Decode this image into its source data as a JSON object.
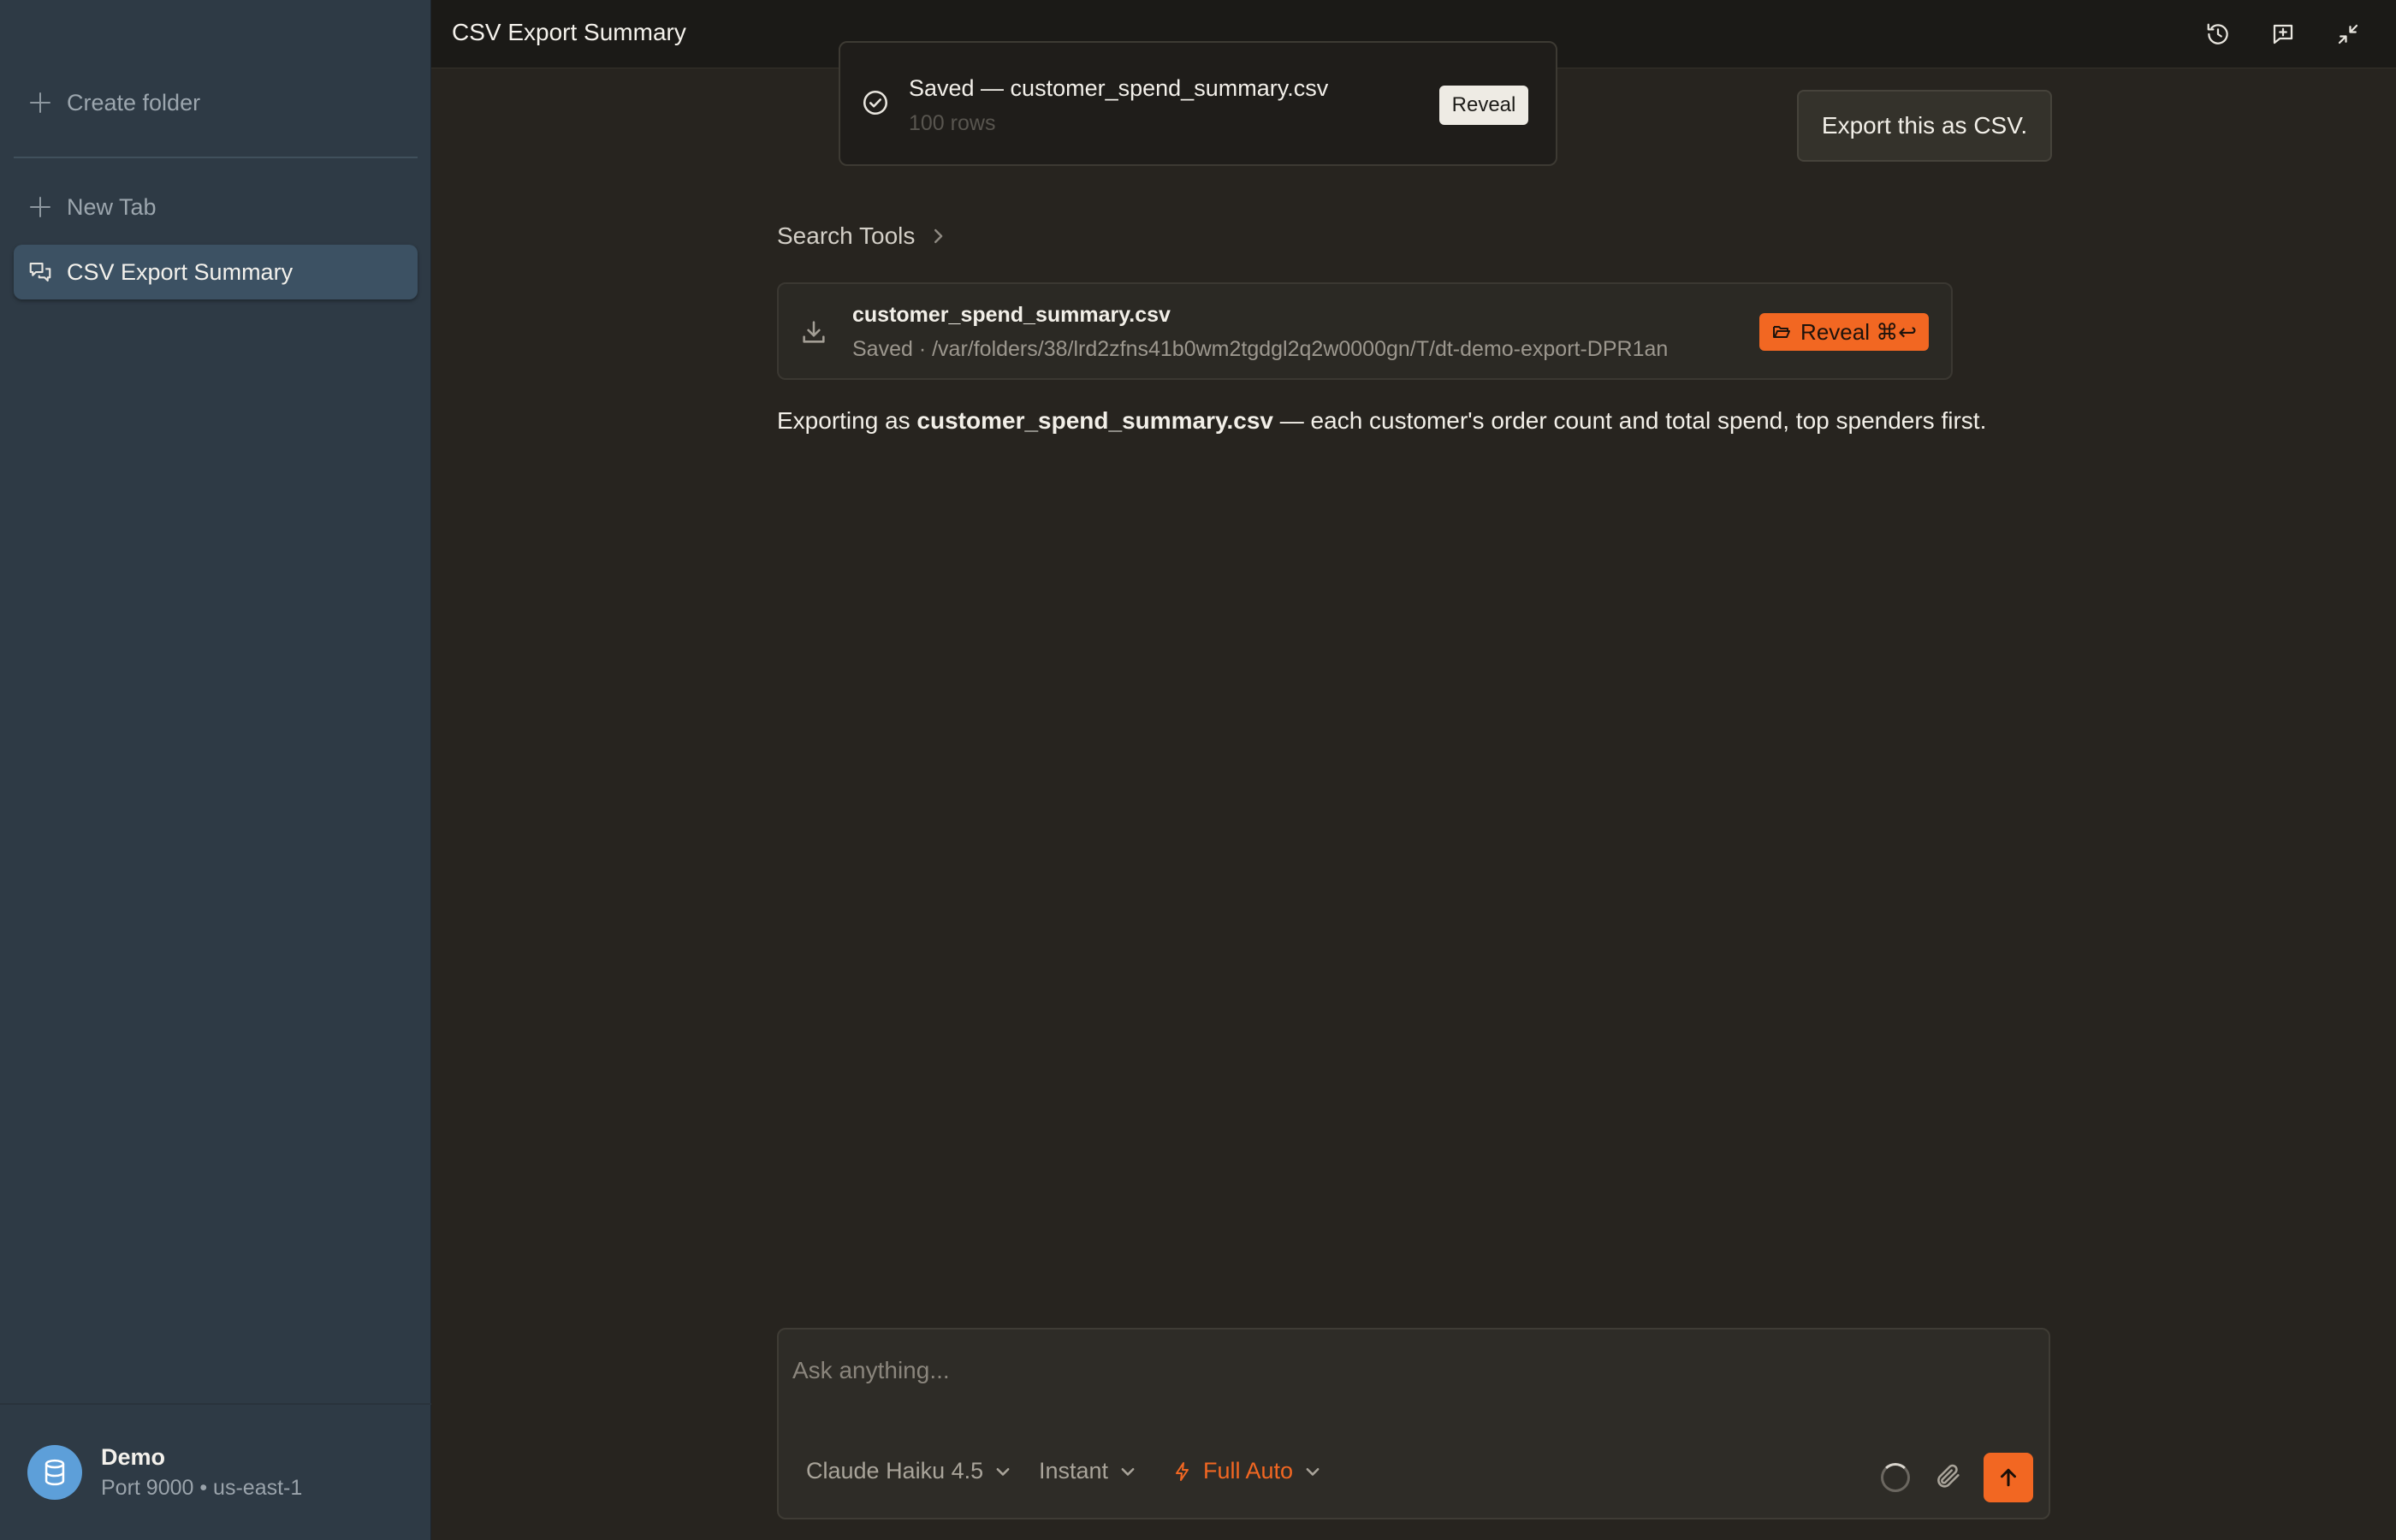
{
  "sidebar": {
    "create_folder": "Create folder",
    "new_tab": "New Tab",
    "active_item": "CSV Export Summary",
    "profile": {
      "name": "Demo",
      "subtitle": "Port 9000 • us-east-1"
    }
  },
  "header": {
    "title": "CSV Export Summary",
    "icons": [
      "history-icon",
      "new-chat-icon",
      "collapse-icon"
    ]
  },
  "toast": {
    "title": "Saved — customer_spend_summary.csv",
    "subtitle": "100 rows",
    "button": "Reveal"
  },
  "chat": {
    "user_message": "Export this as CSV.",
    "tool_group": "Search Tools",
    "file_card": {
      "name": "customer_spend_summary.csv",
      "path": "Saved · /var/folders/38/lrd2zfns41b0wm2tgdgl2q2w0000gn/T/dt-demo-export-DPR1an",
      "button": "Reveal ⌘↩"
    },
    "reply": {
      "prefix": "Exporting as ",
      "filename": "customer_spend_summary.csv",
      "suffix": " — each customer's order count and total spend, top spenders first."
    }
  },
  "composer": {
    "placeholder": "Ask anything...",
    "model": "Claude Haiku 4.5",
    "speed": "Instant",
    "mode": "Full Auto"
  },
  "colors": {
    "accent": "#f26722",
    "sidebar_bg": "#2e3a45",
    "main_bg": "#27241f",
    "avatar": "#5d9fd9"
  }
}
